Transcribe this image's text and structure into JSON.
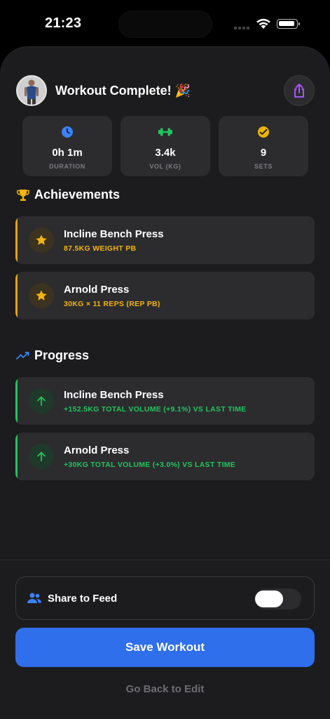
{
  "status": {
    "time": "21:23"
  },
  "header": {
    "title": "Workout Complete! 🎉"
  },
  "stats": [
    {
      "value": "0h 1m",
      "label": "DURATION",
      "icon": "clock-icon",
      "color": "#3b82f6"
    },
    {
      "value": "3.4k",
      "label": "VOL (KG)",
      "icon": "dumbbell-icon",
      "color": "#22c55e"
    },
    {
      "value": "9",
      "label": "SETS",
      "icon": "check-badge-icon",
      "color": "#eab308"
    }
  ],
  "achievements": {
    "title": "Achievements",
    "items": [
      {
        "name": "Incline Bench Press",
        "detail": "87.5KG WEIGHT PB"
      },
      {
        "name": "Arnold Press",
        "detail": "30KG × 11 REPS (REP PB)"
      }
    ]
  },
  "progress": {
    "title": "Progress",
    "items": [
      {
        "name": "Incline Bench Press",
        "detail": "+152.5KG TOTAL VOLUME (+9.1%) VS LAST TIME"
      },
      {
        "name": "Arnold Press",
        "detail": "+30KG TOTAL VOLUME (+3.0%) VS LAST TIME"
      }
    ]
  },
  "feed": {
    "label": "Share to Feed",
    "enabled": false
  },
  "actions": {
    "save_label": "Save Workout",
    "back_label": "Go Back to Edit"
  },
  "colors": {
    "accent_blue": "#2f6fec",
    "gold": "#f5b50a",
    "green": "#22c55e",
    "purple": "#a855f7"
  }
}
